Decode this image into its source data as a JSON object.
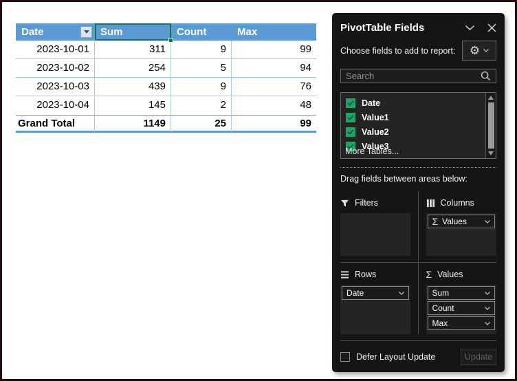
{
  "table": {
    "headers": [
      "Date",
      "Sum",
      "Count",
      "Max"
    ],
    "rows": [
      [
        "2023-10-01",
        "311",
        "9",
        "99"
      ],
      [
        "2023-10-02",
        "254",
        "5",
        "94"
      ],
      [
        "2023-10-03",
        "439",
        "9",
        "76"
      ],
      [
        "2023-10-04",
        "145",
        "2",
        "48"
      ]
    ],
    "grand_total": [
      "Grand Total",
      "1149",
      "25",
      "99"
    ],
    "colors": {
      "header_bg": "#5B9BD5",
      "row_border": "#9DC3E6",
      "selection_green": "#1E7145"
    }
  },
  "panel": {
    "title": "PivotTable Fields",
    "choose_fields_label": "Choose fields to add to report:",
    "search_placeholder": "Search",
    "fields": [
      {
        "name": "Date",
        "checked": true
      },
      {
        "name": "Value1",
        "checked": true
      },
      {
        "name": "Value2",
        "checked": true
      },
      {
        "name": "Value3",
        "checked": true
      }
    ],
    "more_tables_label": "More Tables...",
    "drag_fields_label": "Drag fields between areas below:",
    "areas": {
      "filters": {
        "label": "Filters",
        "items": []
      },
      "columns": {
        "label": "Columns",
        "items": [
          {
            "label": "Values",
            "icon": "sigma"
          }
        ]
      },
      "rows": {
        "label": "Rows",
        "items": [
          {
            "label": "Date"
          }
        ]
      },
      "values": {
        "label": "Values",
        "items": [
          {
            "label": "Sum"
          },
          {
            "label": "Count"
          },
          {
            "label": "Max"
          }
        ]
      }
    },
    "defer_layout_label": "Defer Layout Update",
    "update_button_label": "Update",
    "colors": {
      "panel_bg": "#151515",
      "box_bg": "#242424",
      "checkbox_green": "#21A366"
    }
  }
}
